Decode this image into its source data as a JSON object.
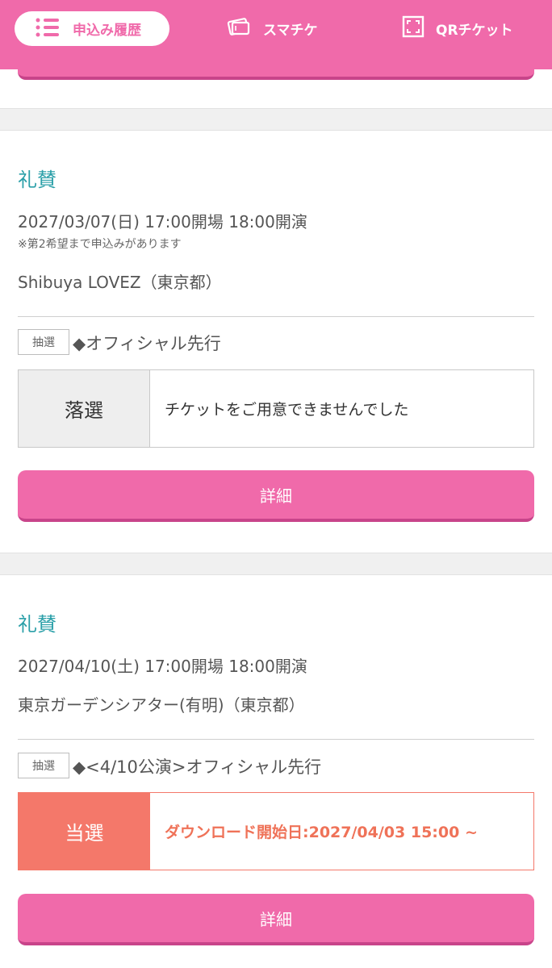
{
  "nav": {
    "tabs": [
      {
        "label": "申込み履歴",
        "icon": "list-icon",
        "active": true
      },
      {
        "label": "スマチケ",
        "icon": "ticket-icon",
        "active": false
      },
      {
        "label": "QRチケット",
        "icon": "qr-scan-icon",
        "active": false
      }
    ]
  },
  "colors": {
    "brand_pink": "#f06aaa",
    "title_teal": "#2a9fa8",
    "win_coral": "#f4786a"
  },
  "entries": [
    {
      "title": "礼賛",
      "date": "2027/03/07(日) 17:00開場 18:00開演",
      "note": "※第2希望まで申込みがあります",
      "venue": "Shibuya LOVEZ（東京都）",
      "badge": "抽選",
      "method": "◆オフィシャル先行",
      "result_label": "落選",
      "result_message": "チケットをご用意できませんでした",
      "detail_label": "詳細"
    },
    {
      "title": "礼賛",
      "date": "2027/04/10(土) 17:00開場 18:00開演",
      "venue": "東京ガーデンシアター(有明)（東京都）",
      "badge": "抽選",
      "method": "◆<4/10公演>オフィシャル先行",
      "result_label": "当選",
      "result_message": "ダウンロード開始日:2027/04/03 15:00 ~",
      "detail_label": "詳細"
    }
  ]
}
